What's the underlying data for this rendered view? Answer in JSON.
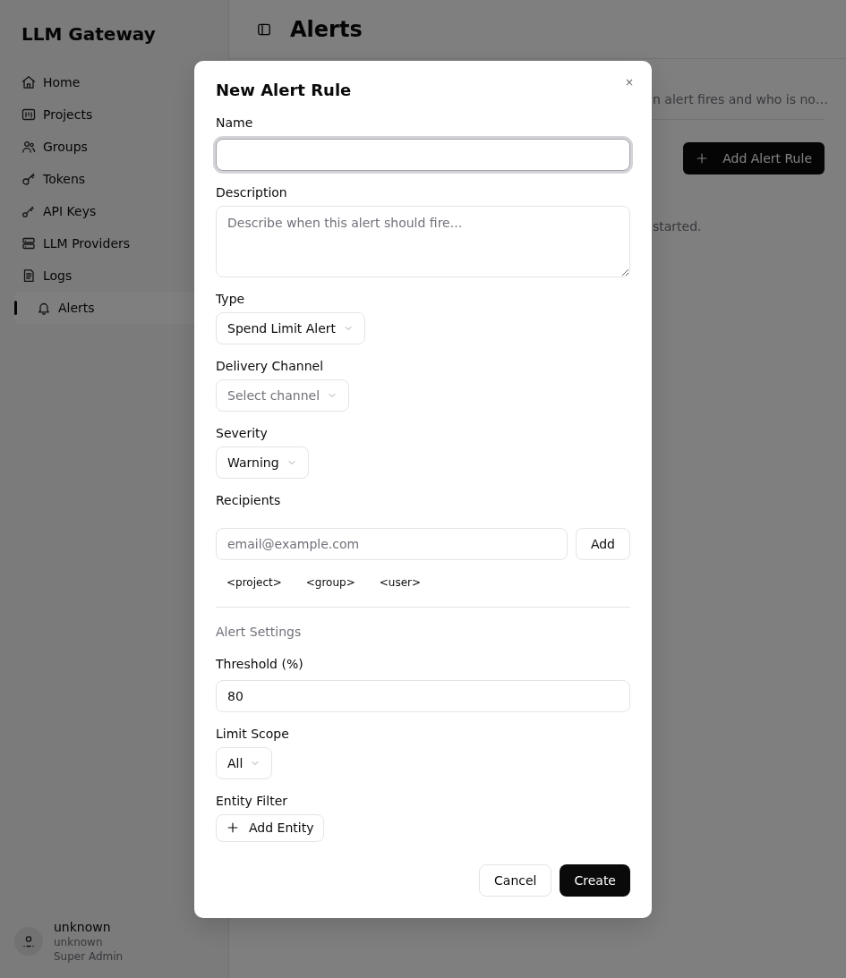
{
  "sidebar": {
    "title": "LLM Gateway",
    "items": [
      {
        "label": "Home",
        "selected": false
      },
      {
        "label": "Projects",
        "selected": false
      },
      {
        "label": "Groups",
        "selected": false
      },
      {
        "label": "Tokens",
        "selected": false
      },
      {
        "label": "API Keys",
        "selected": false
      },
      {
        "label": "LLM Providers",
        "selected": false
      },
      {
        "label": "Logs",
        "selected": false
      },
      {
        "label": "Alerts",
        "selected": true
      }
    ],
    "user": {
      "name": "unknown",
      "detail": "unknown",
      "role": "Super Admin"
    }
  },
  "header": {
    "title": "Alerts"
  },
  "page": {
    "description": "n alert fires and who is no…",
    "add_button": "Add Alert Rule",
    "empty_text": "started."
  },
  "dialog": {
    "title": "New Alert Rule",
    "close": "×",
    "fields": [
      {
        "kind": "text",
        "label": "Name",
        "focused": true
      },
      {
        "kind": "textarea",
        "label": "Description",
        "placeholder": "Describe when this alert should fire..."
      },
      {
        "kind": "select",
        "label": "Type",
        "value": "Spend Limit Alert"
      },
      {
        "kind": "select",
        "label": "Delivery Channel",
        "placeholder": "Select channel"
      },
      {
        "kind": "select",
        "label": "Severity",
        "value": "Warning"
      },
      {
        "kind": "recipients",
        "label": "Recipients",
        "placeholder": "email@example.com",
        "button": "Add",
        "tokens": [
          "<project>",
          "<group>",
          "<user>"
        ]
      },
      {
        "kind": "section",
        "label": "Alert Settings"
      },
      {
        "kind": "text",
        "label": "Threshold (%)",
        "value": "80",
        "focused": false
      },
      {
        "kind": "select",
        "label": "Limit Scope",
        "value": "All"
      },
      {
        "kind": "button",
        "label": "Entity Filter",
        "button": "Add Entity"
      }
    ],
    "buttons": [
      {
        "kind": "secondary",
        "label": "Cancel"
      },
      {
        "kind": "primary",
        "label": "Create"
      }
    ]
  }
}
